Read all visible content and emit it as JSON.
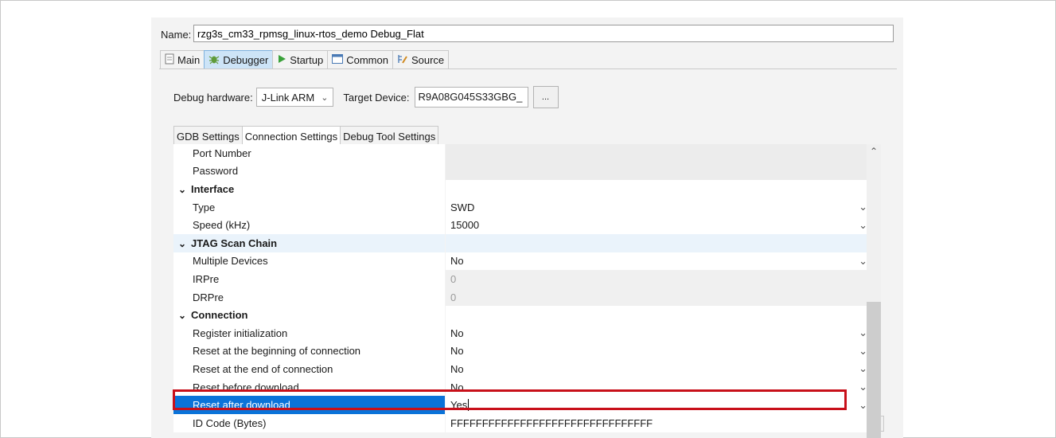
{
  "name": {
    "label": "Name:",
    "value": "rzg3s_cm33_rpmsg_linux-rtos_demo Debug_Flat"
  },
  "tabs": [
    {
      "label": "Main",
      "icon": "page-icon"
    },
    {
      "label": "Debugger",
      "icon": "bug-icon"
    },
    {
      "label": "Startup",
      "icon": "play-icon"
    },
    {
      "label": "Common",
      "icon": "window-icon"
    },
    {
      "label": "Source",
      "icon": "source-icon"
    }
  ],
  "debug_hardware": {
    "label": "Debug hardware:",
    "value": "J-Link ARM"
  },
  "target_device": {
    "label": "Target Device:",
    "value": "R9A08G045S33GBG_",
    "browse": "..."
  },
  "sub_tabs": [
    "GDB Settings",
    "Connection Settings",
    "Debug Tool Settings"
  ],
  "grid": {
    "rows": [
      {
        "label": "Port Number",
        "value": ""
      },
      {
        "label": "Password",
        "value": ""
      },
      {
        "label": "Interface",
        "value": ""
      },
      {
        "label": "Type",
        "value": "SWD"
      },
      {
        "label": "Speed (kHz)",
        "value": "15000"
      },
      {
        "label": "JTAG Scan Chain",
        "value": ""
      },
      {
        "label": "Multiple Devices",
        "value": "No"
      },
      {
        "label": "IRPre",
        "value": "0"
      },
      {
        "label": "DRPre",
        "value": "0"
      },
      {
        "label": "Connection",
        "value": ""
      },
      {
        "label": "Register initialization",
        "value": "No"
      },
      {
        "label": "Reset at the beginning of connection",
        "value": "No"
      },
      {
        "label": "Reset at the end of connection",
        "value": "No"
      },
      {
        "label": "Reset before download",
        "value": "No"
      },
      {
        "label": "Reset after download",
        "value": "Yes"
      },
      {
        "label": "ID Code (Bytes)",
        "value": "FFFFFFFFFFFFFFFFFFFFFFFFFFFFFFFF"
      }
    ],
    "cell_browse": "..."
  },
  "colors": {
    "selected": "#0a73d9",
    "highlight_border": "#c8101a",
    "active_tab": "#cde4f7"
  }
}
